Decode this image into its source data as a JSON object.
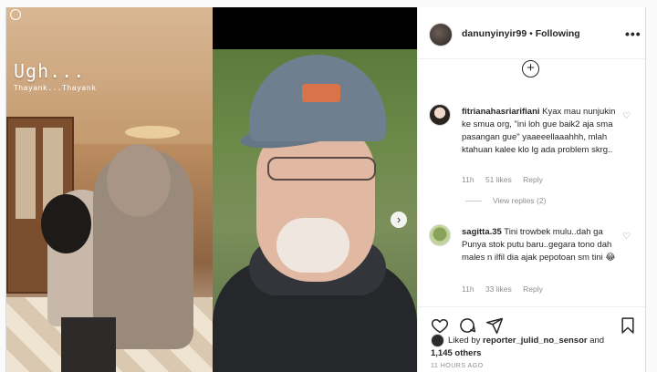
{
  "story": {
    "title": "Ugh...",
    "subtitle": "Thayank...Thayank"
  },
  "post": {
    "username": "danunyinyir99",
    "separator": "•",
    "follow_status": "Following",
    "more_label": "•••"
  },
  "comments": [
    {
      "username": "fitrianahasriarifiani",
      "text": "Kyax mau nunjukin ke smua org, \"ini loh gue baik2 aja sma pasangan gue\" yaaeeellaaahhh, mlah ktahuan kalee klo lg ada problem skrg..",
      "time": "11h",
      "likes": "51 likes",
      "reply": "Reply",
      "view_replies": "View replies (2)"
    },
    {
      "username": "sagitta.35",
      "text": "Tini trowbek mulu..dah ga Punya stok putu baru..gegara tono dah males n ilfil dia ajak pepotoan sm tini 😂",
      "time": "11h",
      "likes": "33 likes",
      "reply": "Reply"
    }
  ],
  "likes_line": {
    "prefix": "Liked by",
    "user": "reporter_julid_no_sensor",
    "and": "and",
    "others": "1,145 others"
  },
  "time_ago": "11 HOURS AGO",
  "icons": {
    "more": "more-options-icon",
    "add": "add-circle-icon",
    "heart": "heart-icon",
    "comment": "comment-icon",
    "share": "share-icon",
    "save": "bookmark-icon",
    "next": "chevron-right-icon"
  },
  "colors": {
    "text": "#262626",
    "muted": "#8e8e8e",
    "border": "#efefef"
  }
}
